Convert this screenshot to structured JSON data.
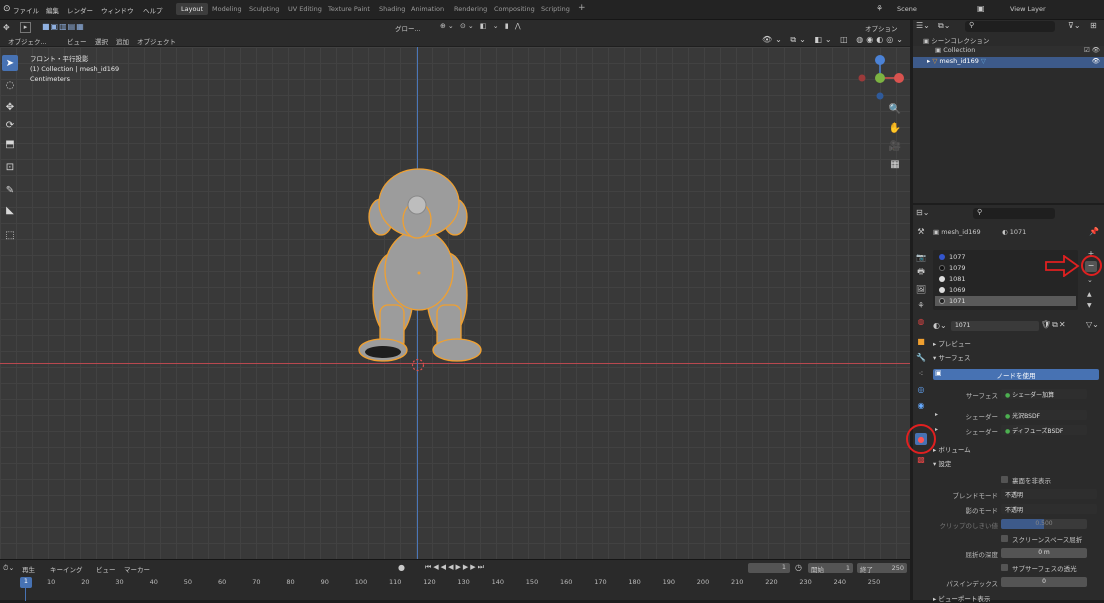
{
  "topbar": {
    "menus": [
      "ファイル",
      "編集",
      "レンダー",
      "ウィンドウ",
      "ヘルプ"
    ],
    "workspaces": [
      "Layout",
      "Modeling",
      "Sculpting",
      "UV Editing",
      "Texture Paint",
      "Shading",
      "Animation",
      "Rendering",
      "Compositing",
      "Scripting"
    ],
    "active_workspace": "Layout",
    "scene": "Scene",
    "view_layer": "View Layer"
  },
  "viewport_header": {
    "mode": "オブジェク...",
    "menus": [
      "ビュー",
      "選択",
      "追加",
      "オブジェクト"
    ],
    "transform": "グロー...",
    "options": "オプション"
  },
  "viewport_info": {
    "view": "フロント・平行投影",
    "collection": "(1) Collection | mesh_id169",
    "units": "Centimeters"
  },
  "timeline": {
    "menus": [
      "再生",
      "キーイング",
      "ビュー",
      "マーカー"
    ],
    "current_frame": "1",
    "start_label": "開始",
    "start": "1",
    "end_label": "終了",
    "end": "250",
    "frames": [
      "1",
      "10",
      "20",
      "30",
      "40",
      "50",
      "60",
      "70",
      "80",
      "90",
      "100",
      "110",
      "120",
      "130",
      "140",
      "150",
      "160",
      "170",
      "180",
      "190",
      "200",
      "210",
      "220",
      "230",
      "240",
      "250"
    ]
  },
  "outliner": {
    "scene_collection": "シーンコレクション",
    "collection": "Collection",
    "object": "mesh_id169"
  },
  "properties": {
    "object_name": "mesh_id169",
    "material_name": "1071",
    "slots": [
      {
        "name": "1077",
        "color": "#3355cc"
      },
      {
        "name": "1079",
        "color": "#111111"
      },
      {
        "name": "1081",
        "color": "#dddddd"
      },
      {
        "name": "1069",
        "color": "#dddddd"
      },
      {
        "name": "1071",
        "color": "#222222"
      }
    ],
    "material_field": "1071",
    "preview": "プレビュー",
    "surface_section": "サーフェス",
    "use_nodes": "ノードを使用",
    "surface_label": "サーフェス",
    "surface_value": "シェーダー加算",
    "shader_label": "シェーダー",
    "shader1": "光沢BSDF",
    "shader2": "ディフューズBSDF",
    "volume": "ボリューム",
    "settings": "設定",
    "backface": "裏面を非表示",
    "blend_label": "ブレンドモード",
    "blend_value": "不透明",
    "shadow_label": "影のモード",
    "shadow_value": "不透明",
    "clip_label": "クリップのしきい値",
    "clip_value": "0.500",
    "ssr": "スクリーンスペース屈折",
    "refr_depth_label": "屈折の深度",
    "refr_depth_value": "0 m",
    "subsurface": "サブサーフェスの透光",
    "pass_index_label": "パスインデックス",
    "pass_index_value": "0",
    "viewport_display": "ビューポート表示"
  },
  "colors": {
    "accent": "#4772b3",
    "annotation": "#e02020",
    "selection_outline": "#f0a030"
  }
}
